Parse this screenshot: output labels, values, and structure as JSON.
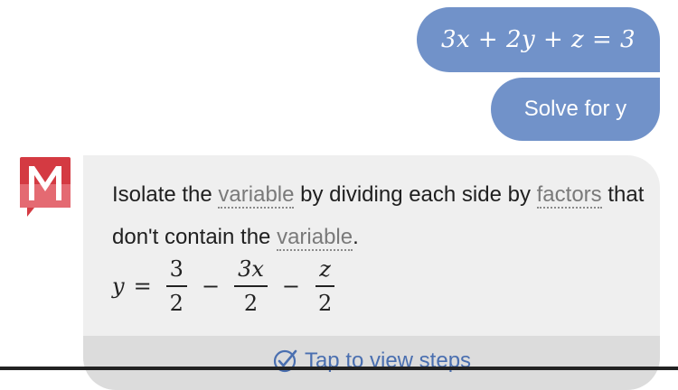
{
  "user_messages": {
    "equation": "3x + 2y + z = 3",
    "instruction": "Solve for y"
  },
  "bot_message": {
    "text_part1": "Isolate the ",
    "term1": "variable",
    "text_part2": " by dividing each side by ",
    "term2": "factors",
    "text_part3": " that don't contain the ",
    "term3": "variable",
    "text_part4": ".",
    "formula": {
      "lhs": "y",
      "equals": "=",
      "frac1": {
        "num": "3",
        "den": "2"
      },
      "op1": "−",
      "frac2": {
        "num": "3x",
        "den": "2"
      },
      "op2": "−",
      "frac3": {
        "num": "z",
        "den": "2"
      }
    },
    "steps_label": "Tap to view steps"
  },
  "colors": {
    "user_bubble": "#7192c9",
    "bot_bubble": "#efefef",
    "accent": "#4a6fb0",
    "logo_red": "#d43a42"
  },
  "icons": {
    "logo": "mathway-logo-icon",
    "check": "check-circle-icon"
  }
}
